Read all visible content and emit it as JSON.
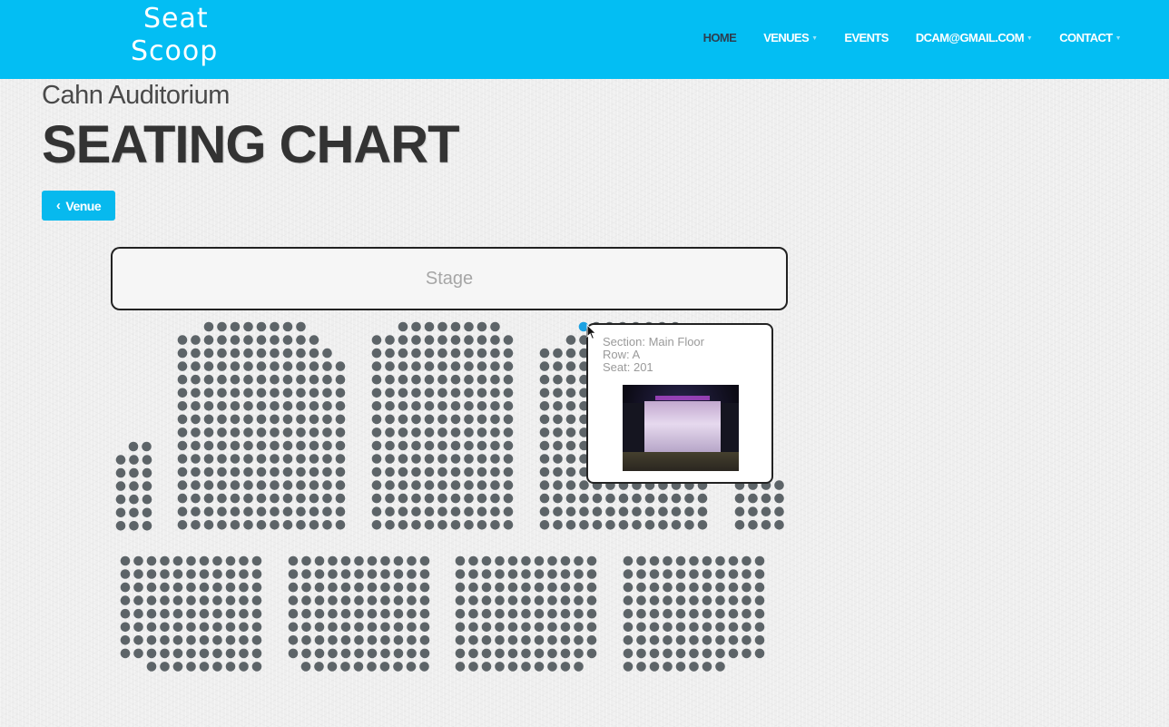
{
  "brand": {
    "logo_line1": "Seat",
    "logo_line2": "Scoop",
    "accent_color": "#03bef3"
  },
  "nav": {
    "home": "HOME",
    "venues": "VENUES",
    "events": "EVENTS",
    "account": "DCAM@GMAIL.COM",
    "contact": "CONTACT"
  },
  "page": {
    "venue_name": "Cahn Auditorium",
    "heading": "SEATING CHART",
    "back_label": "Venue"
  },
  "stage_label": "Stage",
  "seat_popup": {
    "section": "Section: Main Floor",
    "row": "Row: A",
    "seat": "Seat: 201"
  },
  "icons": {
    "back": "chevron-left-icon",
    "dropdown": "caret-down-icon",
    "photo": "stage-photo"
  },
  "colors": {
    "seat": "#5d6468",
    "seat_selected": "#1ba1e2",
    "text_dark": "#333333"
  }
}
